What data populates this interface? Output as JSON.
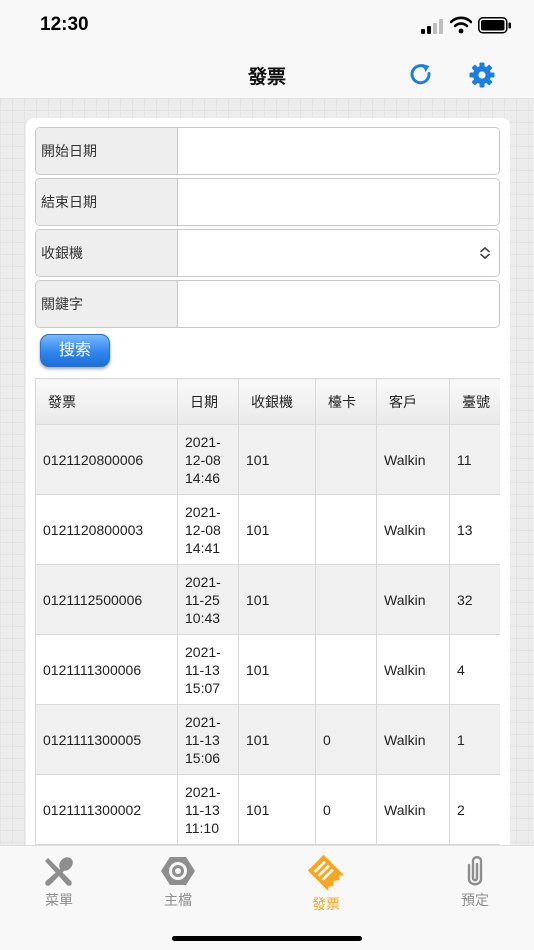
{
  "status_bar": {
    "time": "12:30"
  },
  "nav": {
    "title": "發票"
  },
  "form": {
    "start_date_label": "開始日期",
    "end_date_label": "結束日期",
    "register_label": "收銀機",
    "keyword_label": "關鍵字",
    "start_date_value": "",
    "end_date_value": "",
    "keyword_value": "",
    "search_label": "搜索"
  },
  "table": {
    "headers": [
      "發票",
      "日期",
      "收銀機",
      "檯卡",
      "客戶",
      "臺號"
    ],
    "rows": [
      {
        "invoice": "0121120800006",
        "date_line1": "2021-",
        "date_line2": "12-08",
        "date_line3": "14:46",
        "register": "101",
        "card": "",
        "customer": "Walkin",
        "table_no": "11"
      },
      {
        "invoice": "0121120800003",
        "date_line1": "2021-",
        "date_line2": "12-08",
        "date_line3": "14:41",
        "register": "101",
        "card": "",
        "customer": "Walkin",
        "table_no": "13"
      },
      {
        "invoice": "0121112500006",
        "date_line1": "2021-",
        "date_line2": "11-25",
        "date_line3": "10:43",
        "register": "101",
        "card": "",
        "customer": "Walkin",
        "table_no": "32"
      },
      {
        "invoice": "0121111300006",
        "date_line1": "2021-",
        "date_line2": "11-13",
        "date_line3": "15:07",
        "register": "101",
        "card": "",
        "customer": "Walkin",
        "table_no": "4"
      },
      {
        "invoice": "0121111300005",
        "date_line1": "2021-",
        "date_line2": "11-13",
        "date_line3": "15:06",
        "register": "101",
        "card": "0",
        "customer": "Walkin",
        "table_no": "1"
      },
      {
        "invoice": "0121111300002",
        "date_line1": "2021-",
        "date_line2": "11-13",
        "date_line3": "11:10",
        "register": "101",
        "card": "0",
        "customer": "Walkin",
        "table_no": "2"
      }
    ]
  },
  "tabs": [
    {
      "label": "菜單",
      "icon": "utensils-icon"
    },
    {
      "label": "主檔",
      "icon": "gear-icon"
    },
    {
      "label": "發票",
      "icon": "receipt-icon"
    },
    {
      "label": "預定",
      "icon": "paperclip-icon"
    }
  ],
  "colors": {
    "accent_blue": "#1a7fe0",
    "active_tab": "#f5a623",
    "inactive_tab": "#8e8e8e"
  }
}
